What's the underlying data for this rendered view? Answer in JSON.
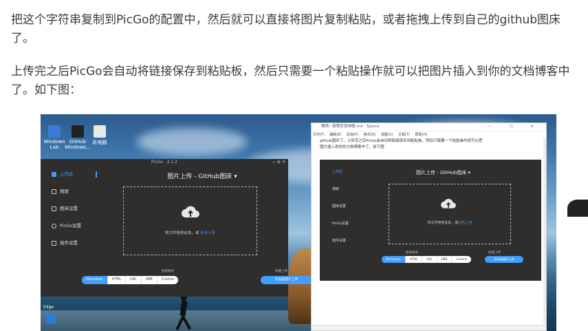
{
  "article": {
    "paragraph1": "把这个字符串复制到PicGo的配置中，然后就可以直接将图片复制粘贴，或者拖拽上传到自己的github图床了。",
    "paragraph2": "上传完之后PicGo会自动将链接保存到粘贴板，然后只需要一个粘贴操作就可以把图片插入到你的文档博客中了。如下图："
  },
  "screenshot": {
    "desktop_icons": [
      "Windows Lab",
      "GitHub Windows...",
      "此电脑"
    ],
    "picgo": {
      "window_title": "PicGo - 2.1.2",
      "window_controls": "— ⊕ ✕",
      "nav": [
        {
          "label": "上传区",
          "icon": "upload-icon",
          "active": true
        },
        {
          "label": "相册",
          "icon": "album-icon",
          "active": false
        },
        {
          "label": "图床设置",
          "icon": "grid-icon",
          "active": false
        },
        {
          "label": "PicGo设置",
          "icon": "gear-icon",
          "active": false
        },
        {
          "label": "插件设置",
          "icon": "share-icon",
          "active": false
        }
      ],
      "heading": "图片上传 - GitHub图床 ▾",
      "drop_hint": "将文件拖到此处，或",
      "drop_link": "点击上传",
      "format_label": "链接格式",
      "formats": [
        "Markdown",
        "HTML",
        "URL",
        "UBB",
        "Custom"
      ],
      "active_format": "Markdown",
      "quick_label": "快捷上传",
      "quick_button": "剪贴板图片上传"
    },
    "typora": {
      "window_title": "懒惰一款程序员神器.md - Typora",
      "window_controls": "— ☐ ✕",
      "menu": [
        "文件(F)",
        "编辑(E)",
        "段落(P)",
        "格式(O)",
        "视图(V)",
        "主题(T)",
        "帮助(H)"
      ],
      "text_line1": "github图床了。上传完之后PicGo会自动将链接保存到粘贴板，然后只需要一个粘贴操作就可以把",
      "text_line2": "图片插入到你的文档博客中了。如下图：",
      "inner_heading": "图片上传 - GitHub图床 ▾",
      "inner_drop_hint": "将文件拖到此处，或",
      "inner_drop_link": "点击上传",
      "inner_format_label": "链接格式",
      "inner_quick_label": "快捷上传",
      "inner_quick_button": "剪贴板图片上传"
    },
    "taskbar_label": "Edge"
  }
}
